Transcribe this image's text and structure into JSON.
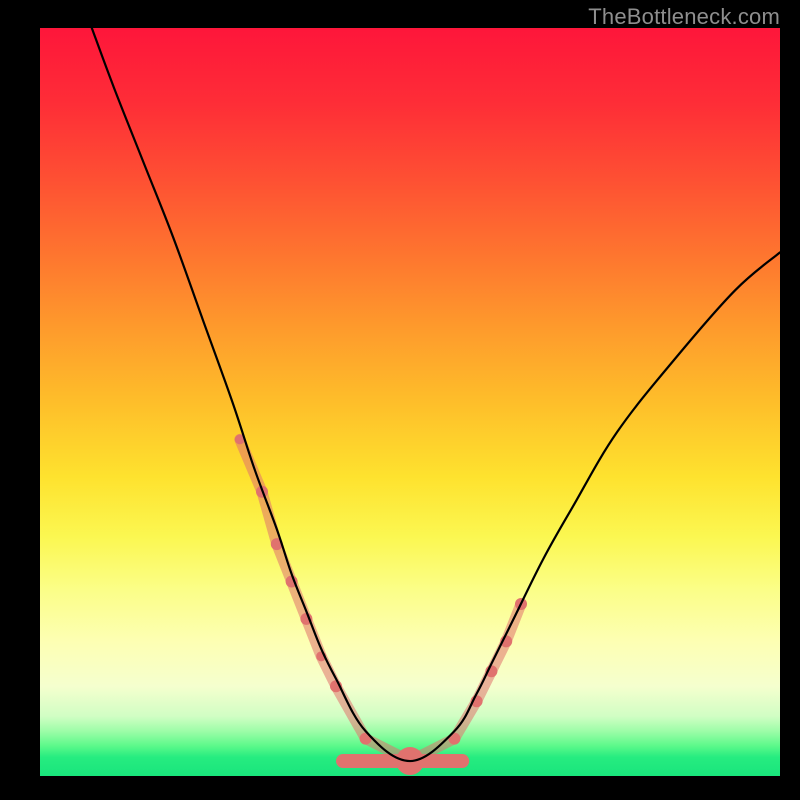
{
  "watermark": "TheBottleneck.com",
  "chart_data": {
    "type": "line",
    "title": "",
    "xlabel": "",
    "ylabel": "",
    "xlim": [
      0,
      100
    ],
    "ylim": [
      0,
      100
    ],
    "grid": false,
    "legend": false,
    "curve_black": {
      "x": [
        7,
        10,
        14,
        18,
        22,
        26,
        29,
        32,
        34,
        36,
        38,
        40,
        44,
        50,
        56,
        59,
        61,
        64,
        68,
        72,
        78,
        86,
        94,
        100
      ],
      "y": [
        100,
        92,
        82,
        72,
        61,
        50,
        41,
        33,
        27,
        22,
        17,
        13,
        6,
        2,
        6,
        11,
        15,
        21,
        29,
        36,
        46,
        56,
        65,
        70
      ]
    },
    "pink_band": {
      "x": [
        27,
        30,
        32,
        34,
        36,
        38,
        40,
        44,
        50,
        56,
        59,
        61,
        63,
        65
      ],
      "y": [
        45,
        38,
        31,
        26,
        21,
        16,
        12,
        5,
        2,
        5,
        10,
        14,
        18,
        23
      ],
      "radii": [
        5,
        6,
        6,
        6,
        6,
        5,
        6,
        6,
        14,
        6,
        6,
        6,
        6,
        6
      ]
    },
    "flat_pink_bottom": {
      "x0": 40,
      "x1": 58,
      "y": 2
    },
    "background_gradient_rows": [
      {
        "y": 0,
        "color": "#fe163a"
      },
      {
        "y": 10,
        "color": "#fe2d37"
      },
      {
        "y": 20,
        "color": "#fe4f33"
      },
      {
        "y": 30,
        "color": "#fe742f"
      },
      {
        "y": 40,
        "color": "#fe9a2c"
      },
      {
        "y": 50,
        "color": "#febe2a"
      },
      {
        "y": 60,
        "color": "#fee22e"
      },
      {
        "y": 68,
        "color": "#fbf751"
      },
      {
        "y": 75,
        "color": "#fbfe87"
      },
      {
        "y": 82,
        "color": "#fdffb3"
      },
      {
        "y": 88,
        "color": "#f5ffce"
      },
      {
        "y": 92,
        "color": "#d1fec4"
      },
      {
        "y": 94,
        "color": "#9dfda8"
      },
      {
        "y": 96,
        "color": "#5bf98a"
      },
      {
        "y": 97.5,
        "color": "#26ec80"
      },
      {
        "y": 100,
        "color": "#19e57c"
      }
    ]
  }
}
